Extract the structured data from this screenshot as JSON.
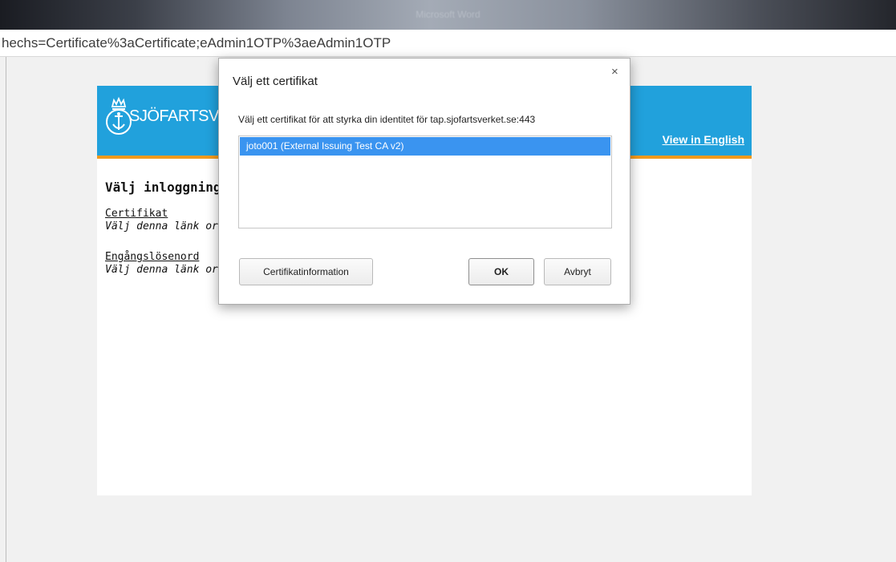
{
  "browser": {
    "url_fragment": "hechs=Certificate%3aCertificate;eAdmin1OTP%3aeAdmin1OTP"
  },
  "page": {
    "logo_text": "SJÖFARTSV",
    "view_in_english": "View in English",
    "heading": "Välj inloggning",
    "options": [
      {
        "link": "Certifikat",
        "description": "Välj denna länk or"
      },
      {
        "link": "Engångslösenord",
        "description": "Välj denna länk or"
      }
    ]
  },
  "dialog": {
    "title": "Välj ett certifikat",
    "close": "×",
    "prompt": "Välj ett certifikat för att styrka din identitet för tap.sjofartsverket.se:443",
    "certificates": [
      "joto001 (External Issuing Test CA v2)"
    ],
    "buttons": {
      "info": "Certifikatinformation",
      "ok": "OK",
      "cancel": "Avbryt"
    }
  },
  "colors": {
    "banner": "#21a1dc",
    "accent_stripe": "#f39a1d",
    "selection": "#3a94f0"
  }
}
